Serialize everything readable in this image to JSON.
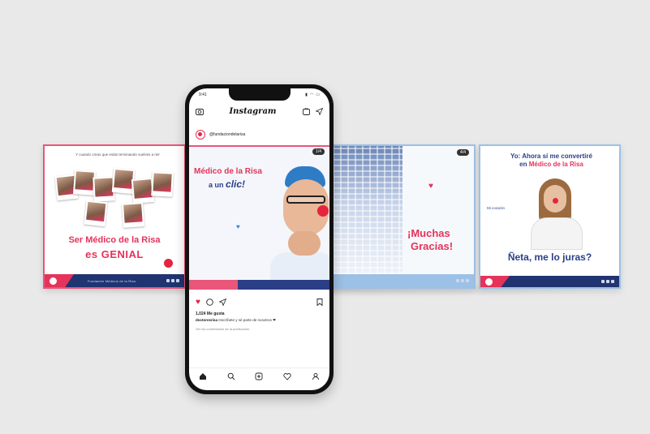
{
  "colors": {
    "background": "#e9e9e9",
    "brand_pink": "#e5335a",
    "brand_navy": "#2b3f86",
    "accent_blue": "#9cc1e6"
  },
  "phone": {
    "status": {
      "time": "9:41",
      "signal_icon": "signal-icon",
      "wifi_icon": "wifi-icon",
      "battery_icon": "battery-icon"
    },
    "header": {
      "logo": "Instagram",
      "camera_icon": "camera-icon",
      "igtv_icon": "tv-icon",
      "direct_icon": "paper-plane-icon"
    },
    "post": {
      "username": "@fundaciondelarisa",
      "badge": "1/4",
      "image_text_1": "Médico de la Risa",
      "image_text_2": "a un",
      "image_text_3": "clic!",
      "likes": "1,024 Me gusta",
      "caption_user": "doctoresrisa",
      "caption_text": "Inscríbete y sé parte de nosotros ❤",
      "comments": "Ver los comentarios de la publicación"
    },
    "nav": [
      "home-icon",
      "search-icon",
      "add-icon",
      "heart-icon",
      "profile-icon"
    ]
  },
  "cards": [
    {
      "id": "card-1",
      "top_text": "Y cuando creas que estás terminando vuelves a reir",
      "title_1": "Ser Médico de la Risa",
      "title_2": "es GENIAL",
      "footer_text": "Fundación Médicos de la Risa"
    },
    {
      "id": "card-3",
      "badge": "4/4",
      "title_1": "¡Muchas",
      "title_2": "Gracias!"
    },
    {
      "id": "card-4",
      "line_1": "Yo: Ahora sí me convertiré",
      "line_2_pre": "en",
      "line_2_highlight": "Médico de la Risa",
      "small": "Mi corazón",
      "title": "Ñeta, me lo juras?"
    }
  ]
}
